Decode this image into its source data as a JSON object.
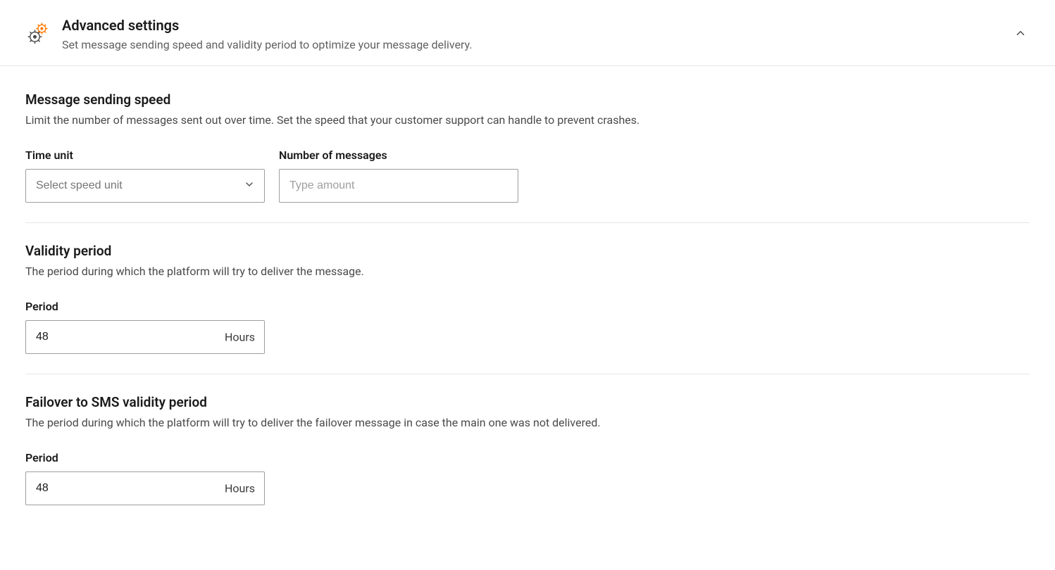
{
  "header": {
    "title": "Advanced settings",
    "description": "Set message sending speed and validity period to optimize your message delivery."
  },
  "sections": {
    "speed": {
      "title": "Message sending speed",
      "description": "Limit the number of messages sent out over time. Set the speed that your customer support can handle to prevent crashes.",
      "timeUnit": {
        "label": "Time unit",
        "placeholder": "Select speed unit",
        "value": ""
      },
      "numMessages": {
        "label": "Number of messages",
        "placeholder": "Type amount",
        "value": ""
      }
    },
    "validity": {
      "title": "Validity period",
      "description": "The period during which the platform will try to deliver the message.",
      "period": {
        "label": "Period",
        "value": "48",
        "unit": "Hours"
      }
    },
    "failover": {
      "title": "Failover to SMS validity period",
      "description": "The period during which the platform will try to deliver the failover message in case the main one was not delivered.",
      "period": {
        "label": "Period",
        "value": "48",
        "unit": "Hours"
      }
    }
  }
}
